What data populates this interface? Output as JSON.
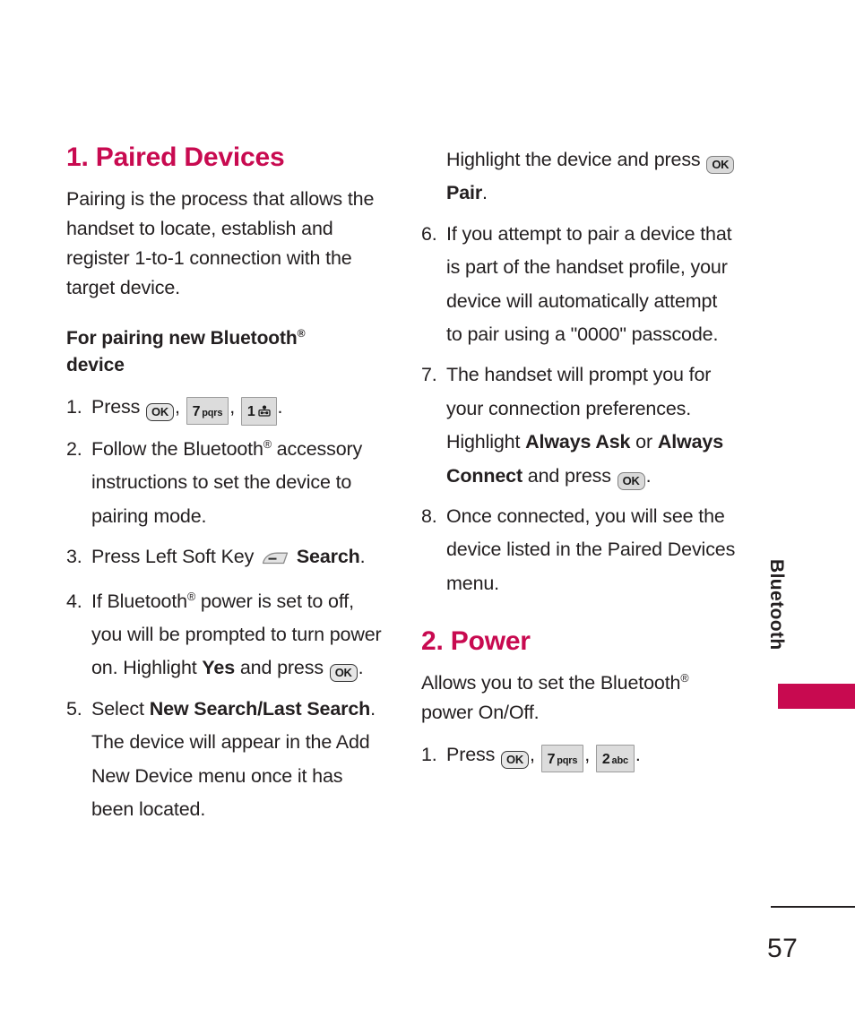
{
  "page": {
    "number": "57",
    "side_tab_label": "Bluetooth",
    "accent_color": "#c80a50",
    "text_color": "#231f20"
  },
  "keys": {
    "ok": "OK",
    "seven_digit": "7",
    "seven_letters": "pqrs",
    "one_digit": "1",
    "one_letters": "voicemail-glyph",
    "two_digit": "2",
    "two_letters": "abc",
    "left_soft_key": "left-soft-key-glyph"
  },
  "left_column": {
    "heading": "1. Paired Devices",
    "intro": "Pairing is the process that allows the handset to locate, establish and register 1-to-1 connection with the target device.",
    "subheading_prefix": "For pairing new Bluetooth",
    "subheading_reg": "®",
    "subheading_suffix": "device",
    "steps": [
      {
        "num": "1.",
        "pre": "Press",
        "post": "."
      },
      {
        "num": "2.",
        "text_a": "Follow the Bluetooth",
        "reg": "®",
        "text_b": " accessory instructions to set the device to pairing mode."
      },
      {
        "num": "3.",
        "pre": "Press Left Soft Key",
        "bold": "Search",
        "post": "."
      },
      {
        "num": "4.",
        "text_a": "If Bluetooth",
        "reg": "®",
        "text_b": " power is set to off, you will be prompted to turn power on. Highlight ",
        "bold": "Yes",
        "text_c": " and press ",
        "post": "."
      },
      {
        "num": "5.",
        "text_a": "Select ",
        "bold": "New Search/Last Search",
        "text_b": ". The device will appear in the Add New Device menu once it has been located."
      }
    ]
  },
  "right_column": {
    "continuation": {
      "text_a": "Highlight the device and press ",
      "bold": "Pair",
      "text_b": "."
    },
    "steps": [
      {
        "num": "6.",
        "text": "If you attempt to pair a device that is part of the handset profile, your device will automatically attempt to pair using a \"0000\" passcode."
      },
      {
        "num": "7.",
        "text_a": "The handset will prompt you for your connection preferences. Highlight ",
        "bold_a": "Always Ask",
        "text_b": " or ",
        "bold_b": "Always Connect",
        "text_c": " and press ",
        "post": "."
      },
      {
        "num": "8.",
        "text": "Once connected, you will see the device listed in the Paired Devices menu."
      }
    ],
    "heading": "2. Power",
    "intro_a": "Allows you to set the Bluetooth",
    "intro_reg": "®",
    "intro_b": " power On/Off.",
    "power_step": {
      "num": "1.",
      "pre": "Press",
      "post": "."
    }
  }
}
